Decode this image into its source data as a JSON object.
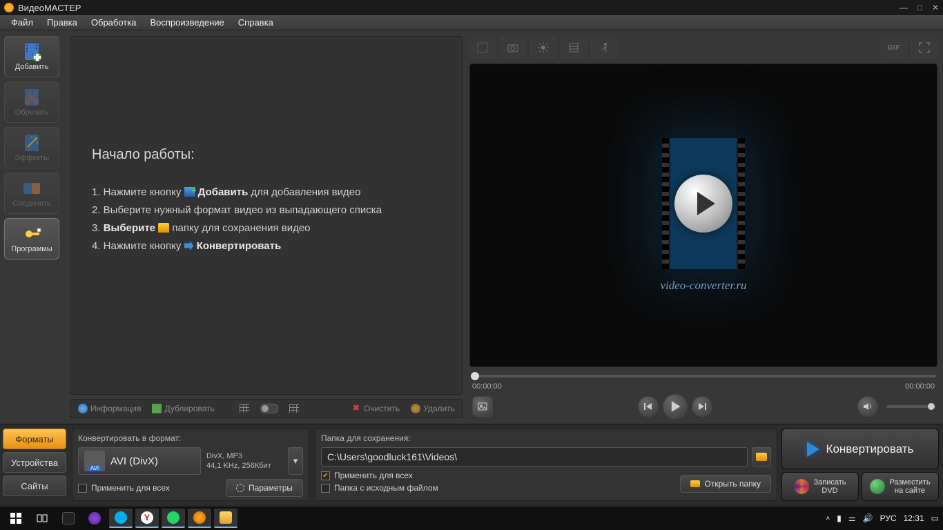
{
  "app": {
    "title": "ВидеоМАСТЕР"
  },
  "menu": {
    "file": "Файл",
    "edit": "Правка",
    "process": "Обработка",
    "playback": "Воспроизведение",
    "help": "Справка"
  },
  "sidebar": {
    "add": "Добавить",
    "crop": "Обрезать",
    "effects": "Эффекты",
    "join": "Соединить",
    "programs": "Программы"
  },
  "start": {
    "heading": "Начало работы:",
    "step1_a": "1. Нажмите кнопку ",
    "step1_b": "Добавить",
    "step1_c": " для добавления видео",
    "step2": "2. Выберите нужный формат видео из выпадающего списка",
    "step3_a": "3. ",
    "step3_b": "Выберите",
    "step3_c": " папку для сохранения видео",
    "step4_a": "4. Нажмите кнопку ",
    "step4_b": "Конвертировать"
  },
  "file_toolbar": {
    "info": "Информация",
    "dup": "Дублировать",
    "clear": "Очистить",
    "del": "Удалить"
  },
  "preview": {
    "splash": "video-converter.ru",
    "time_start": "00:00:00",
    "time_end": "00:00:00",
    "gif": "GIF"
  },
  "tabs": {
    "formats": "Форматы",
    "devices": "Устройства",
    "sites": "Сайты"
  },
  "format_box": {
    "label": "Конвертировать в формат:",
    "name": "AVI (DivX)",
    "codec_line": "DivX, MP3",
    "audio_line": "44,1 KHz, 256Кбит",
    "apply_all": "Применить для всех",
    "params": "Параметры"
  },
  "folder_box": {
    "label": "Папка для сохранения:",
    "path": "C:\\Users\\goodluck161\\Videos\\",
    "apply_all": "Применить для всех",
    "source_folder": "Папка с исходным файлом",
    "open_folder": "Открыть папку"
  },
  "actions": {
    "convert": "Конвертировать",
    "burn_dvd1": "Записать",
    "burn_dvd2": "DVD",
    "publish1": "Разместить",
    "publish2": "на сайте"
  },
  "tray": {
    "lang": "РУС",
    "time": "12:31"
  }
}
